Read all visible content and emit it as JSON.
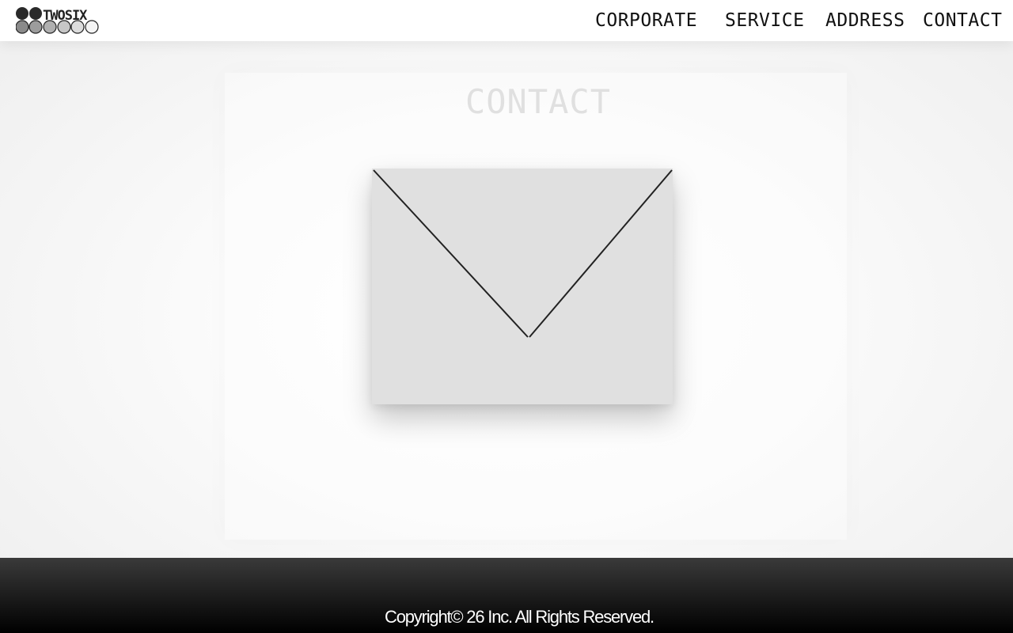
{
  "header": {
    "logo_text": "TWOSIX",
    "nav": [
      {
        "label": "CORPORATE"
      },
      {
        "label": "SERVICE"
      },
      {
        "label": "ADDRESS"
      },
      {
        "label": "CONTACT"
      }
    ]
  },
  "main": {
    "title": "CONTACT",
    "envelope_icon": "envelope-icon"
  },
  "footer": {
    "copyright": "Copyright© 26 Inc. All Rights Reserved."
  },
  "colors": {
    "header_bg": "#ffffff",
    "nav_text": "#111111",
    "title_text": "#e0e0e0",
    "envelope_fill": "#e0e0e0",
    "envelope_stroke": "#222222",
    "footer_bg": "#000000",
    "footer_text": "#ffffff"
  }
}
